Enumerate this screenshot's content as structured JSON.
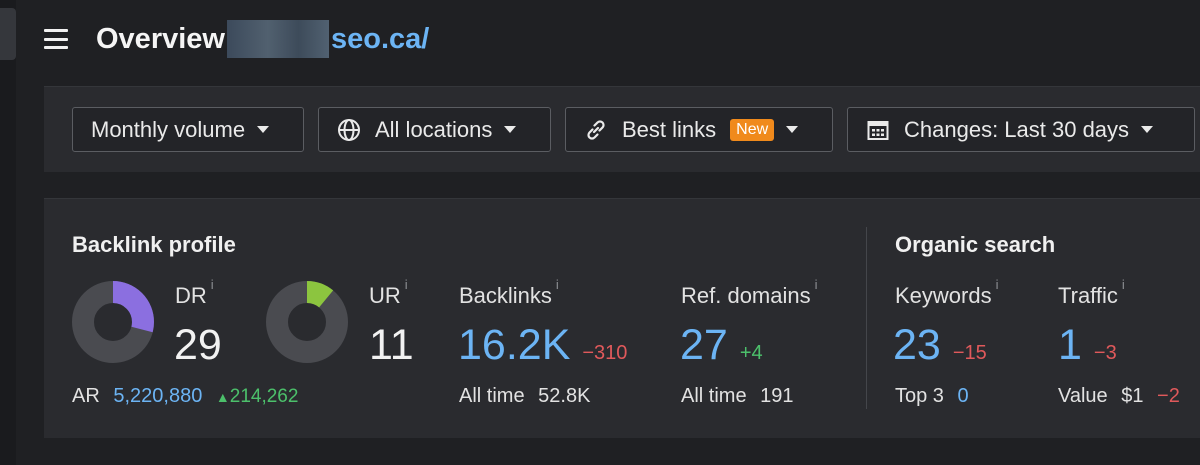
{
  "header": {
    "title": "Overview",
    "url_fragment": "seo.ca/"
  },
  "filters": {
    "volume": "Monthly volume",
    "locations": "All locations",
    "best_links": "Best links",
    "best_links_badge": "New",
    "changes": "Changes: Last 30 days"
  },
  "backlink_profile": {
    "title": "Backlink profile",
    "dr": {
      "label": "DR",
      "value": "29",
      "fraction": 0.29,
      "color": "#8b6fe0"
    },
    "ur": {
      "label": "UR",
      "value": "11",
      "fraction": 0.11,
      "color": "#8cc53f"
    },
    "info_glyph": "i",
    "ar": {
      "label": "AR",
      "value": "5,220,880",
      "delta": "214,262"
    },
    "backlinks": {
      "label": "Backlinks",
      "value": "16.2K",
      "delta": "−310",
      "sub_label": "All time",
      "sub_value": "52.8K"
    },
    "ref_domains": {
      "label": "Ref. domains",
      "value": "27",
      "delta": "+4",
      "sub_label": "All time",
      "sub_value": "191"
    }
  },
  "organic_search": {
    "title": "Organic search",
    "keywords": {
      "label": "Keywords",
      "value": "23",
      "delta": "−15",
      "sub_label": "Top 3",
      "sub_value": "0"
    },
    "traffic": {
      "label": "Traffic",
      "value": "1",
      "delta": "−3",
      "sub_label": "Value",
      "sub_value": "$1",
      "sub_delta": "−2"
    }
  },
  "colors": {
    "accent_blue": "#6cb4f4",
    "negative": "#e0595b",
    "positive": "#4cc06b",
    "badge": "#f08a1c"
  }
}
